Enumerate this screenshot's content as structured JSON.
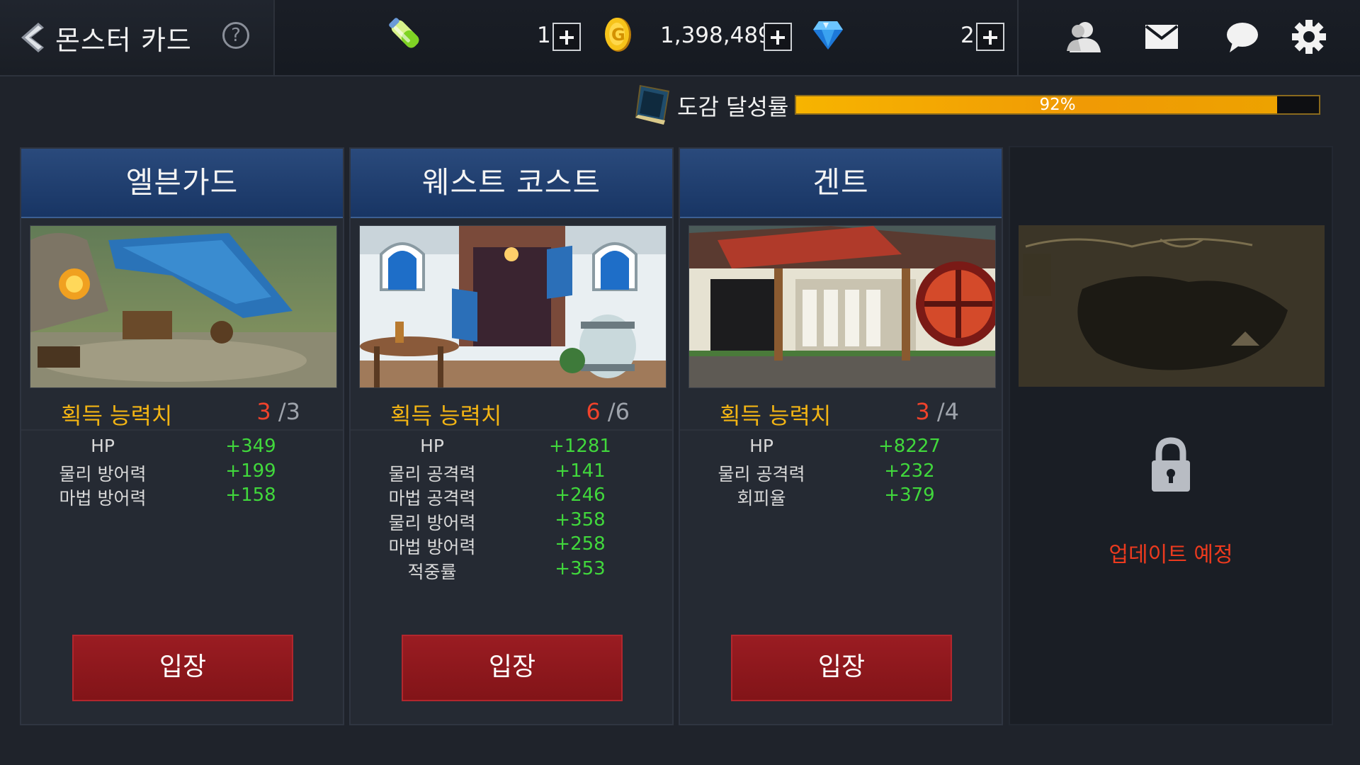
{
  "header": {
    "title": "몬스터 카드",
    "back_icon": "chevron-left-icon",
    "help_label": "?",
    "resources": [
      {
        "icon": "energy-potion-icon",
        "value": "1"
      },
      {
        "icon": "gold-coin-icon",
        "value": "1,398,489"
      },
      {
        "icon": "diamond-gem-icon",
        "value": "2"
      }
    ],
    "icons": [
      "friends-icon",
      "mail-icon",
      "chat-icon",
      "settings-gear-icon"
    ]
  },
  "collection": {
    "label": "도감 달성률",
    "progress_text": "92%",
    "progress_value": 0.92,
    "fill_color": "#f7b400"
  },
  "stat_heading": "획득 능력치",
  "enter_label": "입장",
  "cards": [
    {
      "title": "엘븐가드",
      "current": "3",
      "total": "/3",
      "stats": [
        {
          "name": "HP",
          "value": "+349"
        },
        {
          "name": "물리 방어력",
          "value": "+199"
        },
        {
          "name": "마법 방어력",
          "value": "+158"
        }
      ]
    },
    {
      "title": "웨스트 코스트",
      "current": "6",
      "total": "/6",
      "stats": [
        {
          "name": "HP",
          "value": "+1281"
        },
        {
          "name": "물리 공격력",
          "value": "+141"
        },
        {
          "name": "마법 공격력",
          "value": "+246"
        },
        {
          "name": "물리 방어력",
          "value": "+358"
        },
        {
          "name": "마법 방어력",
          "value": "+258"
        },
        {
          "name": "적중률",
          "value": "+353"
        }
      ]
    },
    {
      "title": "겐트",
      "current": "3",
      "total": "/4",
      "stats": [
        {
          "name": "HP",
          "value": "+8227"
        },
        {
          "name": "물리 공격력",
          "value": "+232"
        },
        {
          "name": "회피율",
          "value": "+379"
        }
      ]
    }
  ],
  "locked": {
    "text": "업데이트 예정",
    "icon": "lock-icon"
  },
  "colors": {
    "stat_label": "#f2b414",
    "stat_value": "#41d83c",
    "count_current": "#f0422b",
    "button": "#9a1c22",
    "locked_text": "#ec3a1e"
  }
}
